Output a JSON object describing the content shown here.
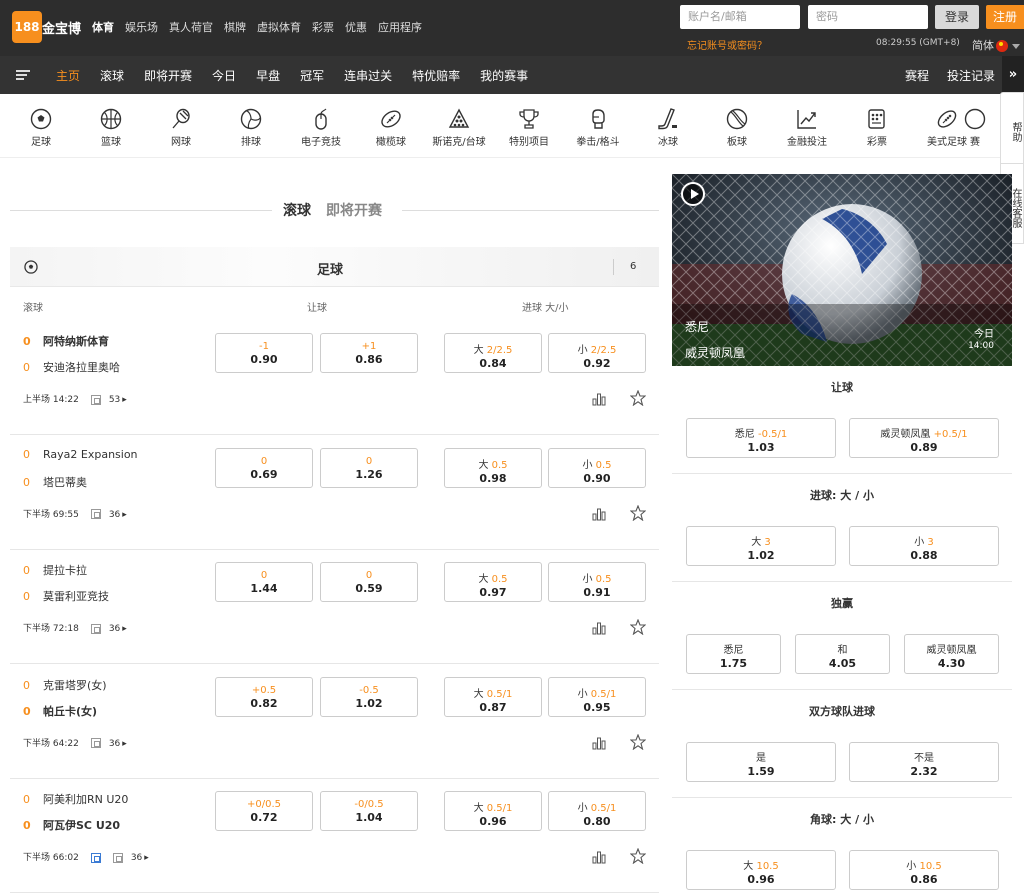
{
  "header": {
    "logo_number": "188",
    "logo_text": "金宝博",
    "nav": [
      "体育",
      "娱乐场",
      "真人荷官",
      "棋牌",
      "虚拟体育",
      "彩票",
      "优惠",
      "应用程序"
    ],
    "username_placeholder": "账户名/邮箱",
    "password_placeholder": "密码",
    "login_label": "登录",
    "register_label": "注册",
    "forgot_label": "忘记账号或密码？",
    "clock": "08:29:55 (GMT+8)",
    "language": "简体"
  },
  "subnav": {
    "items": [
      "主页",
      "滚球",
      "即将开赛",
      "今日",
      "早盘",
      "冠军",
      "连串过关",
      "特优赔率",
      "我的赛事"
    ],
    "results_label": "赛程",
    "history_label": "投注记录",
    "expand_glyph": "»"
  },
  "sports": [
    "足球",
    "篮球",
    "网球",
    "排球",
    "电子竞技",
    "橄榄球",
    "斯诺克/台球",
    "特别项目",
    "拳击/格斗",
    "冰球",
    "板球",
    "金融投注",
    "彩票",
    "美式足球",
    "赛"
  ],
  "side_tabs": {
    "help": "帮助",
    "chat": "在线客服"
  },
  "tabs": {
    "live": "滚球",
    "upcoming": "即将开赛"
  },
  "sport_header": {
    "name": "足球",
    "count": "6"
  },
  "columns": {
    "live": "滚球",
    "handicap": "让球",
    "ou": "进球 大/小"
  },
  "matches": [
    {
      "home": "阿特纳斯体育",
      "away": "安迪洛拉里奥哈",
      "home_score": "0",
      "away_score": "0",
      "home_bold": true,
      "away_bold": false,
      "odds": [
        {
          "h": "-1",
          "v": "0.90"
        },
        {
          "h": "+1",
          "v": "0.86"
        },
        {
          "p": "大",
          "h": "2/2.5",
          "v": "0.84"
        },
        {
          "p": "小",
          "h": "2/2.5",
          "v": "0.92"
        }
      ],
      "time": "上半场 14:22",
      "more": "53",
      "tv": false
    },
    {
      "home": "Raya2 Expansion",
      "away": "塔巴蒂奥",
      "home_score": "0",
      "away_score": "0",
      "home_bold": false,
      "away_bold": false,
      "odds": [
        {
          "h": "0",
          "v": "0.69"
        },
        {
          "h": "0",
          "v": "1.26"
        },
        {
          "p": "大",
          "h": "0.5",
          "v": "0.98"
        },
        {
          "p": "小",
          "h": "0.5",
          "v": "0.90"
        }
      ],
      "time": "下半场 69:55",
      "more": "36",
      "tv": false
    },
    {
      "home": "提拉卡拉",
      "away": "莫雷利亚竞技",
      "home_score": "0",
      "away_score": "0",
      "home_bold": false,
      "away_bold": false,
      "odds": [
        {
          "h": "0",
          "v": "1.44"
        },
        {
          "h": "0",
          "v": "0.59"
        },
        {
          "p": "大",
          "h": "0.5",
          "v": "0.97"
        },
        {
          "p": "小",
          "h": "0.5",
          "v": "0.91"
        }
      ],
      "time": "下半场 72:18",
      "more": "36",
      "tv": false
    },
    {
      "home": "克雷塔罗(女)",
      "away": "帕丘卡(女)",
      "home_score": "0",
      "away_score": "0",
      "home_bold": false,
      "away_bold": true,
      "odds": [
        {
          "h": "+0.5",
          "v": "0.82"
        },
        {
          "h": "-0.5",
          "v": "1.02"
        },
        {
          "p": "大",
          "h": "0.5/1",
          "v": "0.87"
        },
        {
          "p": "小",
          "h": "0.5/1",
          "v": "0.95"
        }
      ],
      "time": "下半场 64:22",
      "more": "36",
      "tv": false
    },
    {
      "home": "阿美利加RN U20",
      "away": "阿瓦伊SC U20",
      "home_score": "0",
      "away_score": "0",
      "home_bold": false,
      "away_bold": true,
      "odds": [
        {
          "h": "+0/0.5",
          "v": "0.72"
        },
        {
          "h": "-0/0.5",
          "v": "1.04"
        },
        {
          "p": "大",
          "h": "0.5/1",
          "v": "0.96"
        },
        {
          "p": "小",
          "h": "0.5/1",
          "v": "0.80"
        }
      ],
      "time": "下半场 66:02",
      "more": "36",
      "tv": true
    }
  ],
  "featured": {
    "home": "悉尼",
    "away": "威灵顿凤凰",
    "day": "今日",
    "time": "14:00",
    "markets": [
      {
        "title": "让球",
        "odds": [
          {
            "name": "悉尼",
            "line": "-0.5/1",
            "v": "1.03"
          },
          {
            "name": "威灵顿凤凰",
            "line": "+0.5/1",
            "v": "0.89"
          }
        ]
      },
      {
        "title": "进球: 大 / 小",
        "odds": [
          {
            "name": "大",
            "line": "3",
            "v": "1.02"
          },
          {
            "name": "小",
            "line": "3",
            "v": "0.88"
          }
        ]
      },
      {
        "title": "独赢",
        "odds": [
          {
            "name": "悉尼",
            "line": "",
            "v": "1.75"
          },
          {
            "name": "和",
            "line": "",
            "v": "4.05"
          },
          {
            "name": "威灵顿凤凰",
            "line": "",
            "v": "4.30"
          }
        ]
      },
      {
        "title": "双方球队进球",
        "odds": [
          {
            "name": "是",
            "line": "",
            "v": "1.59"
          },
          {
            "name": "不是",
            "line": "",
            "v": "2.32"
          }
        ]
      },
      {
        "title": "角球: 大 / 小",
        "odds": [
          {
            "name": "大",
            "line": "10.5",
            "v": "0.96"
          },
          {
            "name": "小",
            "line": "10.5",
            "v": "0.86"
          }
        ]
      }
    ]
  },
  "colors": {
    "accent": "#f78f1e",
    "topbar": "#2d2d2d",
    "subnav": "#333333"
  }
}
